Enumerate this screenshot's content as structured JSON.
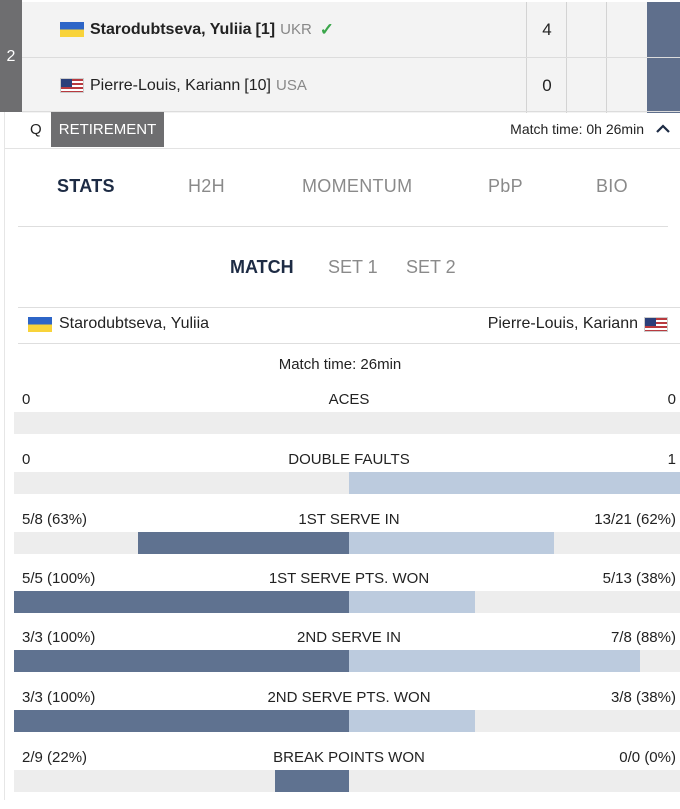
{
  "scoreboard": {
    "round": "2",
    "players": [
      {
        "name": "Starodubtseva, Yuliia",
        "seed": "[1]",
        "country": "UKR",
        "flag": "ukraine-flag-icon",
        "winner_mark": "✓",
        "scores": [
          "4",
          "",
          ""
        ]
      },
      {
        "name": "Pierre-Louis, Kariann",
        "seed": "[10]",
        "country": "USA",
        "flag": "usa-flag-icon",
        "scores": [
          "0",
          "",
          ""
        ]
      }
    ]
  },
  "info": {
    "q_label": "Q",
    "status": "RETIREMENT",
    "match_time": "Match time: 0h 26min"
  },
  "tabs": [
    "STATS",
    "H2H",
    "MOMENTUM",
    "PbP",
    "BIO"
  ],
  "sub_tabs": [
    "MATCH",
    "SET 1",
    "SET 2"
  ],
  "players_header": {
    "left": "Starodubtseva, Yuliia",
    "right": "Pierre-Louis, Kariann"
  },
  "match_time_center": "Match time: 26min",
  "stats": [
    {
      "label": "ACES",
      "left": "0",
      "right": "0",
      "left_fraction": 0.0,
      "right_fraction": 0.0
    },
    {
      "label": "DOUBLE FAULTS",
      "left": "0",
      "right": "1",
      "left_fraction": 0.0,
      "right_fraction": 1.0
    },
    {
      "label": "1ST SERVE IN",
      "left": "5/8 (63%)",
      "right": "13/21 (62%)",
      "left_fraction": 0.63,
      "right_fraction": 0.62
    },
    {
      "label": "1ST SERVE PTS. WON",
      "left": "5/5 (100%)",
      "right": "5/13 (38%)",
      "left_fraction": 1.0,
      "right_fraction": 0.38
    },
    {
      "label": "2ND SERVE IN",
      "left": "3/3 (100%)",
      "right": "7/8 (88%)",
      "left_fraction": 1.0,
      "right_fraction": 0.88
    },
    {
      "label": "2ND SERVE PTS. WON",
      "left": "3/3 (100%)",
      "right": "3/8 (38%)",
      "left_fraction": 1.0,
      "right_fraction": 0.38
    },
    {
      "label": "BREAK POINTS WON",
      "left": "2/9 (22%)",
      "right": "0/0 (0%)",
      "left_fraction": 0.22,
      "right_fraction": 0.0
    }
  ],
  "colors": {
    "bar_left": "#5f7290",
    "bar_right": "#bccbde",
    "track": "#ededed",
    "accent": "#1d2b44"
  }
}
